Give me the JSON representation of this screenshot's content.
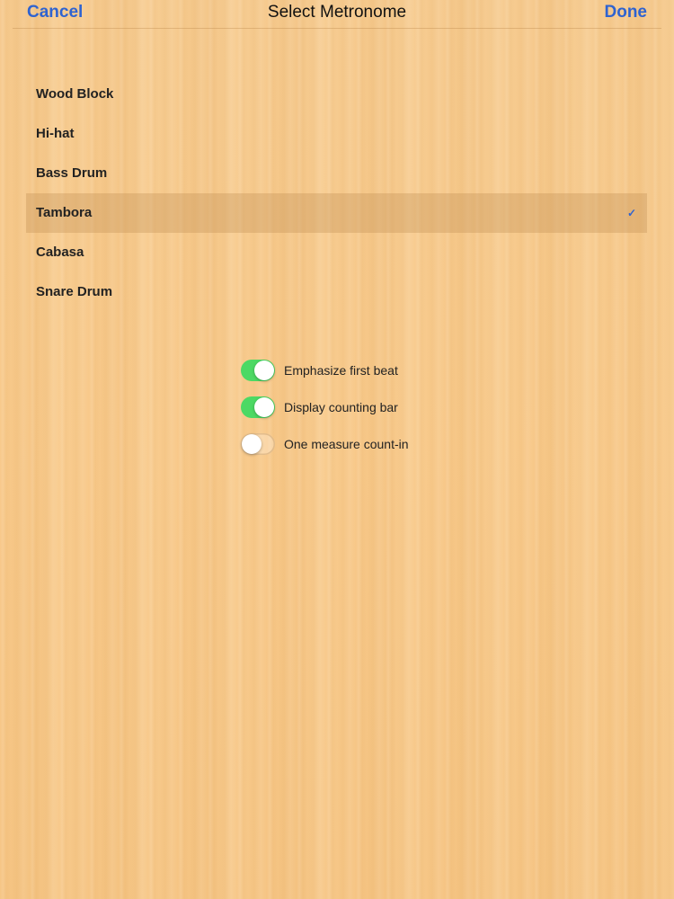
{
  "nav": {
    "cancel_label": "Cancel",
    "title": "Select Metronome",
    "done_label": "Done",
    "accent_color": "#2f63d0"
  },
  "sounds": {
    "items": [
      {
        "label": "Wood Block",
        "selected": false
      },
      {
        "label": "Hi-hat",
        "selected": false
      },
      {
        "label": "Bass Drum",
        "selected": false
      },
      {
        "label": "Tambora",
        "selected": true
      },
      {
        "label": "Cabasa",
        "selected": false
      },
      {
        "label": "Snare Drum",
        "selected": false
      }
    ],
    "checkmark_icon": "checkmark-icon",
    "checkmark_glyph": "✓"
  },
  "options": [
    {
      "label": "Emphasize first beat",
      "on": true
    },
    {
      "label": "Display counting bar",
      "on": true
    },
    {
      "label": "One measure count-in",
      "on": false
    }
  ],
  "colors": {
    "toggle_on": "#4cd964",
    "background": "#f7c98a"
  }
}
